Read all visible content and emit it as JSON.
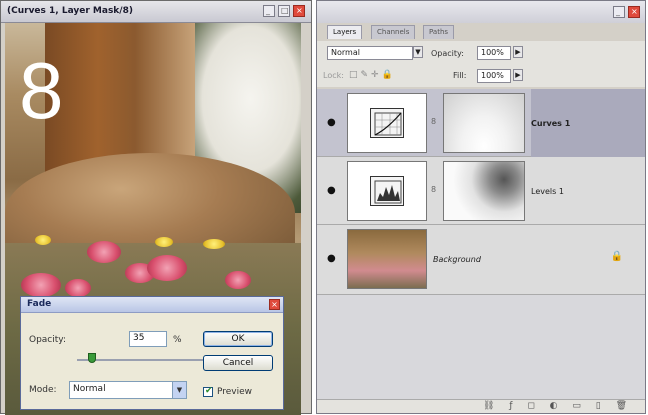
{
  "document": {
    "title": "(Curves 1, Layer Mask/8)",
    "step_number": "8"
  },
  "fade_dialog": {
    "title": "Fade",
    "opacity_label": "Opacity:",
    "opacity_value": "35",
    "percent": "%",
    "ok_label": "OK",
    "cancel_label": "Cancel",
    "mode_label": "Mode:",
    "mode_value": "Normal",
    "preview_label": "Preview",
    "preview_checked": true,
    "opacity_slider_fraction": 0.35
  },
  "layers_panel": {
    "tabs": [
      "Layers",
      "Channels",
      "Paths"
    ],
    "blend_mode": "Normal",
    "opacity_label": "Opacity:",
    "opacity_value": "100%",
    "lock_label": "Lock:",
    "fill_label": "Fill:",
    "fill_value": "100%",
    "layers": [
      {
        "name": "Curves 1",
        "type": "curves-adjustment",
        "visible": true,
        "selected": true
      },
      {
        "name": "Levels 1",
        "type": "levels-adjustment",
        "visible": true,
        "selected": false
      },
      {
        "name": "Background",
        "type": "image",
        "visible": true,
        "selected": false,
        "locked": true
      }
    ]
  },
  "colors": {
    "title_close": "#e04a3c",
    "selected_layer": "#aaaabc"
  }
}
